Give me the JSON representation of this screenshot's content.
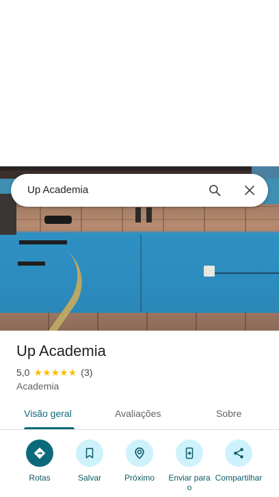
{
  "search": {
    "query": "Up Academia"
  },
  "place": {
    "title": "Up Academia",
    "rating": "5,0",
    "stars": 5,
    "review_count": "(3)",
    "category": "Academia"
  },
  "tabs": [
    {
      "label": "Visão geral",
      "active": true
    },
    {
      "label": "Avaliações",
      "active": false
    },
    {
      "label": "Sobre",
      "active": false
    }
  ],
  "actions": [
    {
      "label": "Rotas",
      "icon": "directions-icon"
    },
    {
      "label": "Salvar",
      "icon": "bookmark-icon"
    },
    {
      "label": "Próximo",
      "icon": "nearby-icon"
    },
    {
      "label": "Enviar para o",
      "icon": "send-to-phone-icon"
    },
    {
      "label": "Compartilhar",
      "icon": "share-icon"
    }
  ],
  "colors": {
    "accent": "#0b6a7a",
    "action_bg": "#cdf2fb",
    "star": "#fbbc04"
  }
}
